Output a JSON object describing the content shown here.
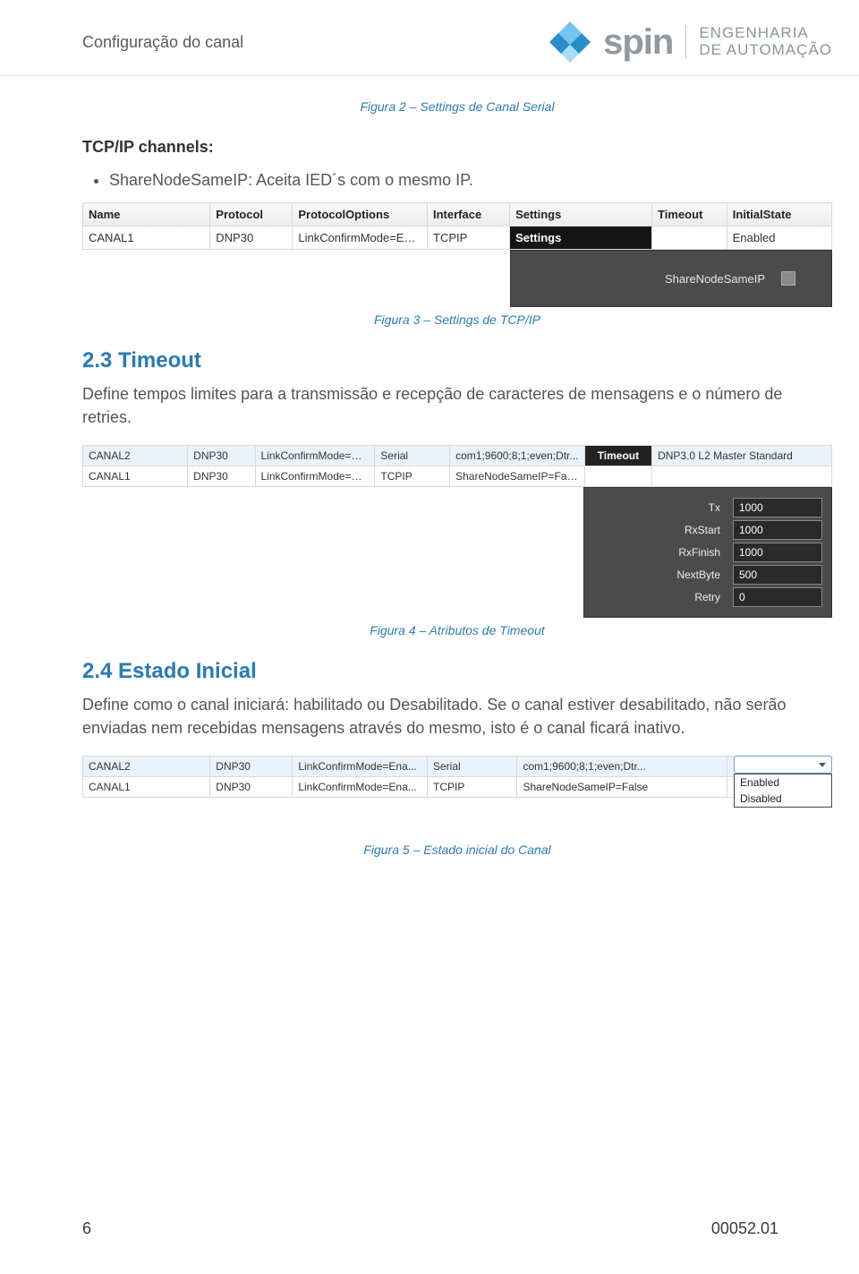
{
  "header": {
    "title": "Configuração do canal",
    "brand": "spin",
    "tagline_l1": "ENGENHARIA",
    "tagline_l2": "DE AUTOMAÇÃO"
  },
  "fig2_caption": "Figura 2 – Settings de Canal Serial",
  "tcpip_heading": "TCP/IP channels:",
  "tcpip_bullet": "ShareNodeSameIP: Aceita IED´s com o mesmo IP.",
  "fig3": {
    "headers": [
      "Name",
      "Protocol",
      "ProtocolOptions",
      "Interface",
      "Settings",
      "Timeout",
      "InitialState"
    ],
    "row": [
      "CANAL1",
      "DNP30",
      "LinkConfirmMode=Ena...",
      "TCPIP",
      "Settings",
      "",
      "Enabled"
    ],
    "panel_label": "ShareNodeSameIP",
    "caption": "Figura 3 – Settings de TCP/IP"
  },
  "sec23_title": "2.3 Timeout",
  "sec23_body": "Define tempos limites para a transmissão e recepção de caracteres de mensagens e o número de retries.",
  "fig4": {
    "rows": [
      [
        "CANAL2",
        "DNP30",
        "LinkConfirmMode=Ena...",
        "Serial",
        "com1;9600;8;1;even;Dtr...",
        "Timeout",
        "DNP3.0 L2 Master Standard"
      ],
      [
        "CANAL1",
        "DNP30",
        "LinkConfirmMode=Ena...",
        "TCPIP",
        "ShareNodeSameIP=False",
        "",
        ""
      ]
    ],
    "panel": [
      {
        "label": "Tx",
        "value": "1000"
      },
      {
        "label": "RxStart",
        "value": "1000"
      },
      {
        "label": "RxFinish",
        "value": "1000"
      },
      {
        "label": "NextByte",
        "value": "500"
      },
      {
        "label": "Retry",
        "value": "0"
      }
    ],
    "caption": "Figura 4 – Atributos de Timeout"
  },
  "sec24_title": "2.4 Estado Inicial",
  "sec24_body": "Define como o canal iniciará: habilitado ou Desabilitado. Se o canal estiver desabilitado, não serão enviadas nem recebidas mensagens através do mesmo, isto é o canal ficará inativo.",
  "fig5": {
    "rows": [
      [
        "CANAL2",
        "DNP30",
        "LinkConfirmMode=Ena...",
        "Serial",
        "com1;9600;8;1;even;Dtr...",
        ""
      ],
      [
        "CANAL1",
        "DNP30",
        "LinkConfirmMode=Ena...",
        "TCPIP",
        "ShareNodeSameIP=False",
        ""
      ]
    ],
    "combo_options": [
      "Enabled",
      "Disabled"
    ],
    "caption": "Figura 5 – Estado inicial do Canal"
  },
  "footer": {
    "page": "6",
    "doc": "00052.01"
  }
}
